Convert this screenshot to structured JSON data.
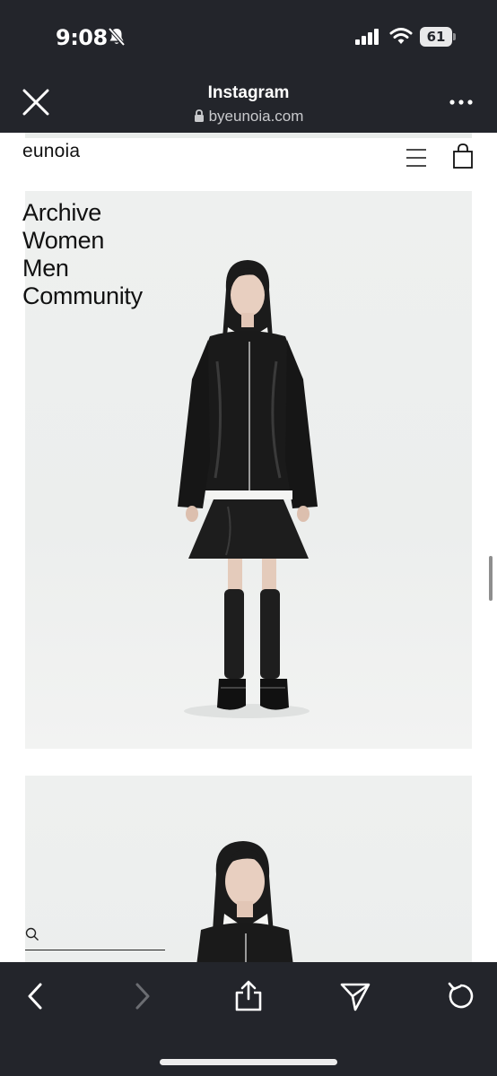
{
  "status_bar": {
    "time": "9:08",
    "battery_level": "61",
    "icons": [
      "bell-slash-icon",
      "cellular-signal-icon",
      "wifi-icon",
      "battery-icon"
    ]
  },
  "browser": {
    "title": "Instagram",
    "url": "byeunoia.com",
    "icons": [
      "close-icon",
      "lock-icon",
      "more-icon"
    ]
  },
  "site": {
    "brand": "eunoia",
    "nav": [
      {
        "label": "Archive"
      },
      {
        "label": "Women"
      },
      {
        "label": "Men"
      },
      {
        "label": "Community"
      }
    ],
    "header_icons": [
      "menu-icon",
      "shopping-bag-icon"
    ],
    "search": {
      "value": "",
      "icon": "search-icon"
    },
    "images": [
      {
        "name": "lookbook-image-full-body",
        "content": "model in black leather jacket, white collared shirt, black skirt, black knee socks and shoes"
      },
      {
        "name": "lookbook-image-portrait",
        "content": "model in black leather jacket over white collar"
      }
    ]
  },
  "toolbar": {
    "buttons": [
      {
        "name": "back-button",
        "icon": "chevron-left-icon",
        "enabled": true
      },
      {
        "name": "forward-button",
        "icon": "chevron-right-icon",
        "enabled": false
      },
      {
        "name": "share-button",
        "icon": "share-icon",
        "enabled": true
      },
      {
        "name": "send-button",
        "icon": "paper-plane-icon",
        "enabled": true
      },
      {
        "name": "reload-button",
        "icon": "reload-icon",
        "enabled": true
      }
    ]
  },
  "colors": {
    "chrome_background": "#23252b",
    "page_background": "#ffffff",
    "photo_background": "#eceeed",
    "text_primary": "#111111",
    "disabled_icon": "#6b6d72"
  }
}
